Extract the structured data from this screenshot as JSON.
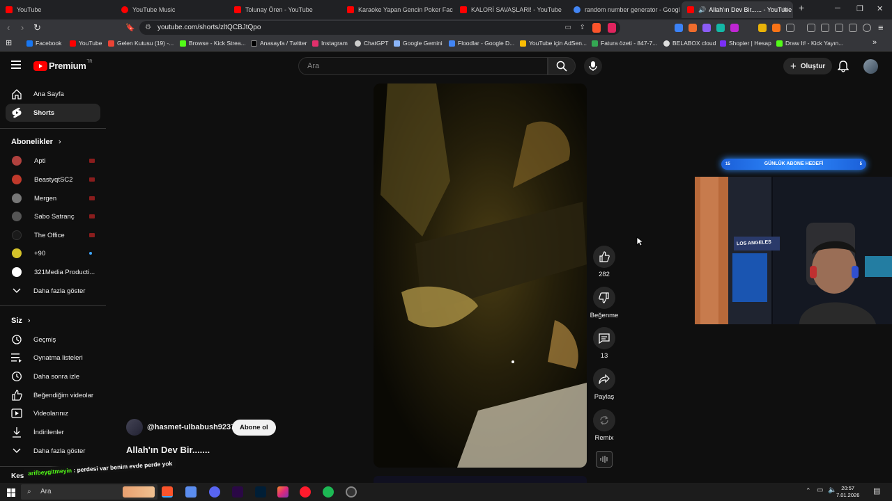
{
  "browser": {
    "tabs": [
      {
        "title": "YouTube",
        "color": "#ff0000"
      },
      {
        "title": "YouTube Music",
        "color": "#ff0000"
      },
      {
        "title": "Tolunay Ören - YouTube",
        "color": "#ff0000"
      },
      {
        "title": "Karaoke Yapan Gencin Poker Face ile",
        "color": "#ff0000"
      },
      {
        "title": "KALORİ SAVAŞLARI! - YouTube",
        "color": "#ff0000"
      },
      {
        "title": "random number generator - Google",
        "color": "#4285f4"
      },
      {
        "title": "Allah'ın Dev Bir...... - YouTube",
        "color": "#ff0000"
      }
    ],
    "url": "youtube.com/shorts/zltQCBJtQpo",
    "bookmarks": [
      {
        "label": "Facebook",
        "color": "#1877f2"
      },
      {
        "label": "YouTube",
        "color": "#ff0000"
      },
      {
        "label": "Gelen Kutusu (19) -...",
        "color": "#ea4335"
      },
      {
        "label": "Browse - Kick Strea...",
        "color": "#53fc18"
      },
      {
        "label": "Anasayfa / Twitter",
        "color": "#000000"
      },
      {
        "label": "Instagram",
        "color": "#e1306c"
      },
      {
        "label": "ChatGPT",
        "color": "#cccccc"
      },
      {
        "label": "Google Gemini",
        "color": "#8ab4f8"
      },
      {
        "label": "Floodlar - Google D...",
        "color": "#4285f4"
      },
      {
        "label": "YouTube için AdSen...",
        "color": "#fbbc04"
      },
      {
        "label": "Fatura özeti - 847-7...",
        "color": "#34a853"
      },
      {
        "label": "BELABOX cloud",
        "color": "#dddddd"
      },
      {
        "label": "Shopier | Hesap",
        "color": "#7b2ff7"
      },
      {
        "label": "Draw It! - Kick Yayın...",
        "color": "#53fc18"
      }
    ]
  },
  "youtube": {
    "logo_text": "Premium",
    "logo_suffix": "TR",
    "search_placeholder": "Ara",
    "create_label": "Oluştur",
    "sidebar": {
      "main": [
        {
          "label": "Ana Sayfa",
          "icon": "home-icon"
        },
        {
          "label": "Shorts",
          "icon": "shorts-icon"
        }
      ],
      "subscriptions_header": "Abonelikler",
      "subscriptions": [
        {
          "label": "Apti",
          "avatar": "#b0413e"
        },
        {
          "label": "BeastyqtSC2",
          "avatar": "#c0392b"
        },
        {
          "label": "Mergen",
          "avatar": "#777777"
        },
        {
          "label": "Sabo Satranç",
          "avatar": "#555555"
        },
        {
          "label": "The Office",
          "avatar": "#1a1a1a"
        },
        {
          "label": "+90",
          "avatar": "#d4c22a"
        },
        {
          "label": "321Media Producti...",
          "avatar": "#ffffff"
        }
      ],
      "show_more": "Daha fazla göster",
      "you_header": "Siz",
      "you_items": [
        {
          "label": "Geçmiş",
          "icon": "history-icon"
        },
        {
          "label": "Oynatma listeleri",
          "icon": "playlists-icon"
        },
        {
          "label": "Daha sonra izle",
          "icon": "watch-later-icon"
        },
        {
          "label": "Beğendiğim videolar",
          "icon": "liked-icon"
        },
        {
          "label": "Videolarınız",
          "icon": "your-videos-icon"
        },
        {
          "label": "İndirilenler",
          "icon": "downloads-icon"
        },
        {
          "label": "Daha fazla göster",
          "icon": "chevron-down-icon"
        }
      ]
    },
    "short": {
      "channel": "@hasmet-ulbabush9237",
      "subscribe_label": "Abone ol",
      "title": "Allah'ın Dev Bir.......",
      "actions": {
        "like_count": "282",
        "dislike_label": "Beğenme",
        "comment_count": "13",
        "share_label": "Paylaş",
        "remix_label": "Remix"
      }
    }
  },
  "overlay": {
    "goal_label": "GÜNLÜK ABONE HEDEFİ",
    "goal_left": "15",
    "goal_right": "5",
    "webcam_sign": "LOS ANGELES",
    "chat_user": "arifbeygitmeyin",
    "chat_text": "perdesi var benim evde perde yok",
    "sidebar_partial": "Kes"
  },
  "taskbar": {
    "search_placeholder": "Ara",
    "time": "20:57",
    "date": "7.01.2026"
  }
}
